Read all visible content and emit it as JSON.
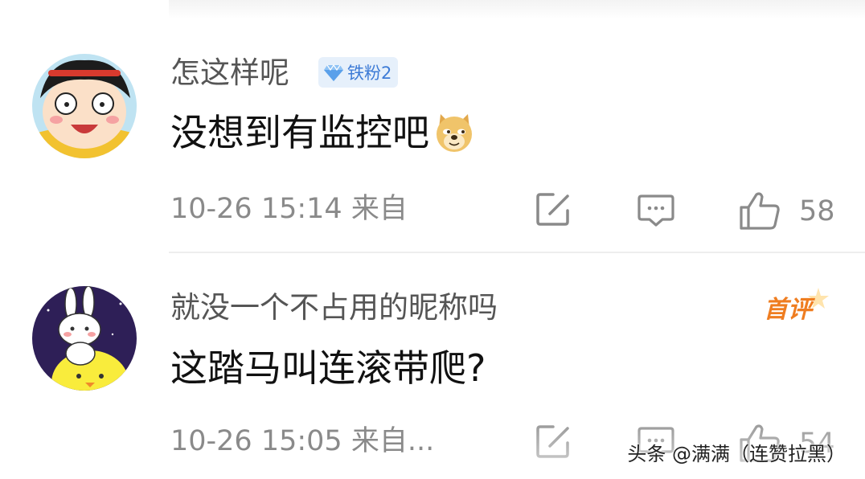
{
  "comments": [
    {
      "username": "怎这样呢",
      "badge": "铁粉2",
      "text": "没想到有监控吧",
      "emoji": "doge-emoji",
      "time": "10-26 15:14",
      "source": "来自",
      "likes": "58"
    },
    {
      "username": "就没一个不占用的昵称吗",
      "first_tag": "首评",
      "text": "这踏马叫连滚带爬?",
      "time": "10-26 15:05",
      "source": "来自...",
      "likes": "54"
    }
  ],
  "icons": {
    "share": "share-edit-icon",
    "reply": "comment-icon",
    "like": "thumbs-up-icon",
    "badge": "diamond-icon"
  },
  "colors": {
    "username": "#555555",
    "meta": "#8a8a8a",
    "badge_bg": "#e6f0fb",
    "badge_text": "#3d7bd6",
    "first_tag": "#ef7d20"
  },
  "watermark": "头条 @满满（连赞拉黑）"
}
